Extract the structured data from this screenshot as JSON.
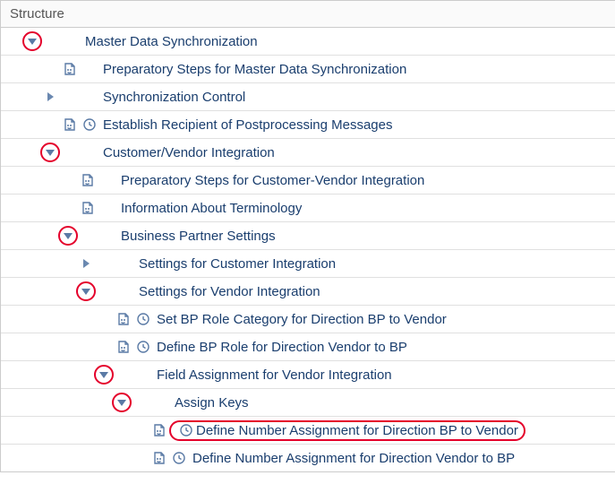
{
  "header": "Structure",
  "rows": [
    {
      "id": "r0",
      "indent": 1,
      "expander": "down",
      "ring": true,
      "doc": false,
      "clock": false,
      "label": "Master Data Synchronization"
    },
    {
      "id": "r1",
      "indent": 2,
      "expander": "none",
      "ring": false,
      "doc": true,
      "clock": false,
      "label": "Preparatory Steps for Master Data Synchronization"
    },
    {
      "id": "r2",
      "indent": 2,
      "expander": "right",
      "ring": false,
      "doc": false,
      "clock": false,
      "label": "Synchronization Control"
    },
    {
      "id": "r3",
      "indent": 2,
      "expander": "none",
      "ring": false,
      "doc": true,
      "clock": true,
      "label": "Establish Recipient of Postprocessing Messages"
    },
    {
      "id": "r4",
      "indent": 2,
      "expander": "down",
      "ring": true,
      "doc": false,
      "clock": false,
      "label": "Customer/Vendor Integration"
    },
    {
      "id": "r5",
      "indent": 3,
      "expander": "none",
      "ring": false,
      "doc": true,
      "clock": false,
      "label": "Preparatory Steps for Customer-Vendor Integration"
    },
    {
      "id": "r6",
      "indent": 3,
      "expander": "none",
      "ring": false,
      "doc": true,
      "clock": false,
      "label": "Information About Terminology"
    },
    {
      "id": "r7",
      "indent": 3,
      "expander": "down",
      "ring": true,
      "doc": false,
      "clock": false,
      "label": "Business Partner Settings"
    },
    {
      "id": "r8",
      "indent": 4,
      "expander": "right",
      "ring": false,
      "doc": false,
      "clock": false,
      "label": "Settings for Customer Integration"
    },
    {
      "id": "r9",
      "indent": 4,
      "expander": "down",
      "ring": true,
      "doc": false,
      "clock": false,
      "label": "Settings for Vendor Integration"
    },
    {
      "id": "r10",
      "indent": 5,
      "expander": "none",
      "ring": false,
      "doc": true,
      "clock": true,
      "label": "Set BP Role Category for Direction BP to Vendor"
    },
    {
      "id": "r11",
      "indent": 5,
      "expander": "none",
      "ring": false,
      "doc": true,
      "clock": true,
      "label": "Define BP Role for Direction Vendor to BP"
    },
    {
      "id": "r12",
      "indent": 5,
      "expander": "down",
      "ring": true,
      "doc": false,
      "clock": false,
      "label": "Field Assignment for Vendor Integration"
    },
    {
      "id": "r13",
      "indent": 6,
      "expander": "down",
      "ring": true,
      "doc": false,
      "clock": false,
      "label": "Assign Keys"
    },
    {
      "id": "r14",
      "indent": 7,
      "expander": "none",
      "ring": false,
      "doc": true,
      "clock": true,
      "label": "Define Number Assignment for Direction BP to Vendor",
      "highlight": true
    },
    {
      "id": "r15",
      "indent": 7,
      "expander": "none",
      "ring": false,
      "doc": true,
      "clock": true,
      "label": "Define Number Assignment for Direction Vendor to BP"
    }
  ]
}
